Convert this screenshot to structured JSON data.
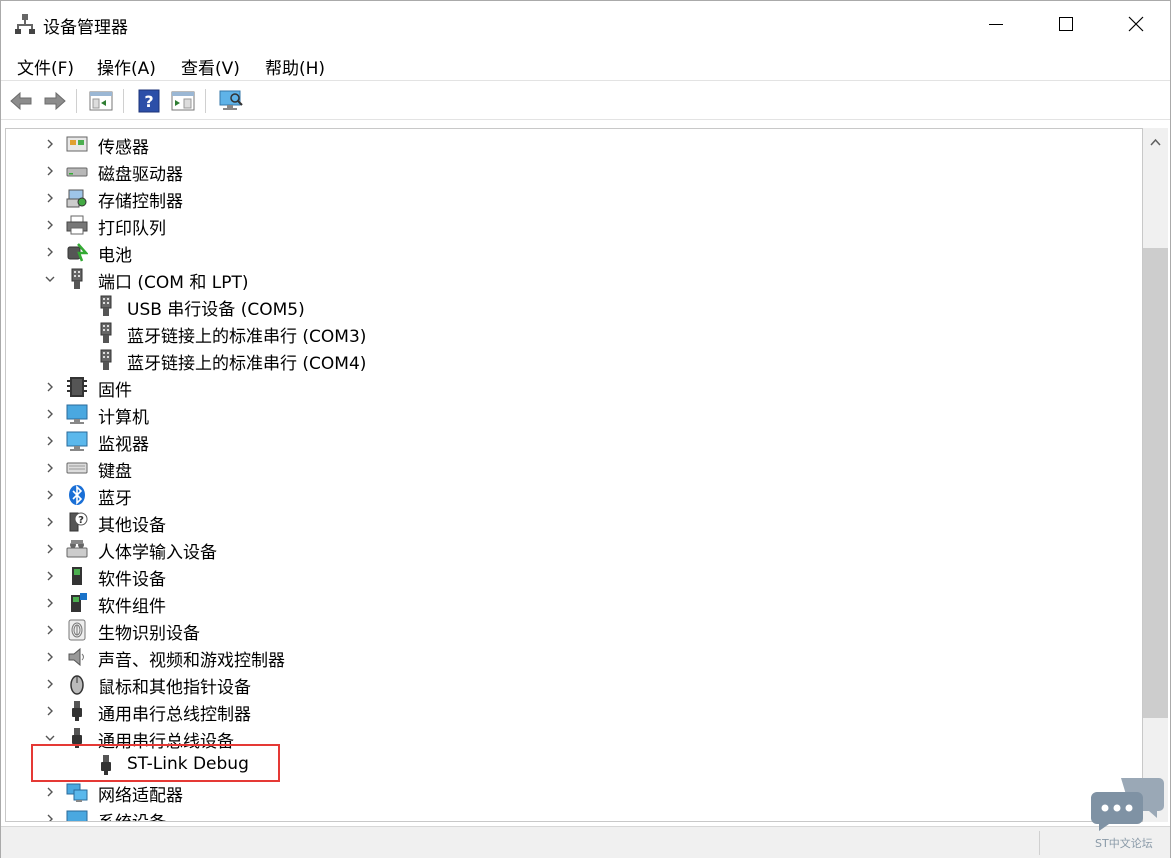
{
  "window": {
    "title": "设备管理器",
    "controls": [
      "minimize",
      "maximize",
      "close"
    ]
  },
  "menu": {
    "items": [
      "文件(F)",
      "操作(A)",
      "查看(V)",
      "帮助(H)"
    ]
  },
  "toolbar": {
    "buttons": [
      "back-icon",
      "forward-icon",
      "properties-icon",
      "help-icon",
      "show-hide-console-tree-icon",
      "scan-hardware-icon"
    ]
  },
  "tree": {
    "rows": [
      {
        "label": "传感器",
        "icon": "sensor-icon",
        "level": 0,
        "expanded": false
      },
      {
        "label": "磁盘驱动器",
        "icon": "disk-drive-icon",
        "level": 0,
        "expanded": false
      },
      {
        "label": "存储控制器",
        "icon": "storage-controller-icon",
        "level": 0,
        "expanded": false
      },
      {
        "label": "打印队列",
        "icon": "printer-icon",
        "level": 0,
        "expanded": false
      },
      {
        "label": "电池",
        "icon": "battery-icon",
        "level": 0,
        "expanded": false
      },
      {
        "label": "端口 (COM 和 LPT)",
        "icon": "port-icon",
        "level": 0,
        "expanded": true
      },
      {
        "label": "USB 串行设备 (COM5)",
        "icon": "port-icon",
        "level": 1
      },
      {
        "label": "蓝牙链接上的标准串行 (COM3)",
        "icon": "port-icon",
        "level": 1
      },
      {
        "label": "蓝牙链接上的标准串行 (COM4)",
        "icon": "port-icon",
        "level": 1
      },
      {
        "label": "固件",
        "icon": "firmware-icon",
        "level": 0,
        "expanded": false
      },
      {
        "label": "计算机",
        "icon": "computer-icon",
        "level": 0,
        "expanded": false
      },
      {
        "label": "监视器",
        "icon": "monitor-icon",
        "level": 0,
        "expanded": false
      },
      {
        "label": "键盘",
        "icon": "keyboard-icon",
        "level": 0,
        "expanded": false
      },
      {
        "label": "蓝牙",
        "icon": "bluetooth-icon",
        "level": 0,
        "expanded": false
      },
      {
        "label": "其他设备",
        "icon": "unknown-device-icon",
        "level": 0,
        "expanded": false
      },
      {
        "label": "人体学输入设备",
        "icon": "hid-icon",
        "level": 0,
        "expanded": false
      },
      {
        "label": "软件设备",
        "icon": "software-device-icon",
        "level": 0,
        "expanded": false
      },
      {
        "label": "软件组件",
        "icon": "software-component-icon",
        "level": 0,
        "expanded": false
      },
      {
        "label": "生物识别设备",
        "icon": "fingerprint-icon",
        "level": 0,
        "expanded": false
      },
      {
        "label": "声音、视频和游戏控制器",
        "icon": "speaker-icon",
        "level": 0,
        "expanded": false
      },
      {
        "label": "鼠标和其他指针设备",
        "icon": "mouse-icon",
        "level": 0,
        "expanded": false
      },
      {
        "label": "通用串行总线控制器",
        "icon": "usb-icon",
        "level": 0,
        "expanded": false
      },
      {
        "label": "通用串行总线设备",
        "icon": "usb-icon",
        "level": 0,
        "expanded": true
      },
      {
        "label": "ST-Link Debug",
        "icon": "usb-icon",
        "level": 1,
        "highlighted": true
      },
      {
        "label": "网络适配器",
        "icon": "network-adapter-icon",
        "level": 0,
        "expanded": false
      },
      {
        "label": "系统设备",
        "icon": "system-device-icon",
        "level": 0,
        "expanded": false
      }
    ]
  },
  "watermark": {
    "text": "ST中文论坛"
  },
  "colors": {
    "highlight_border": "#e53935",
    "link_blue": "#1a73c9"
  }
}
